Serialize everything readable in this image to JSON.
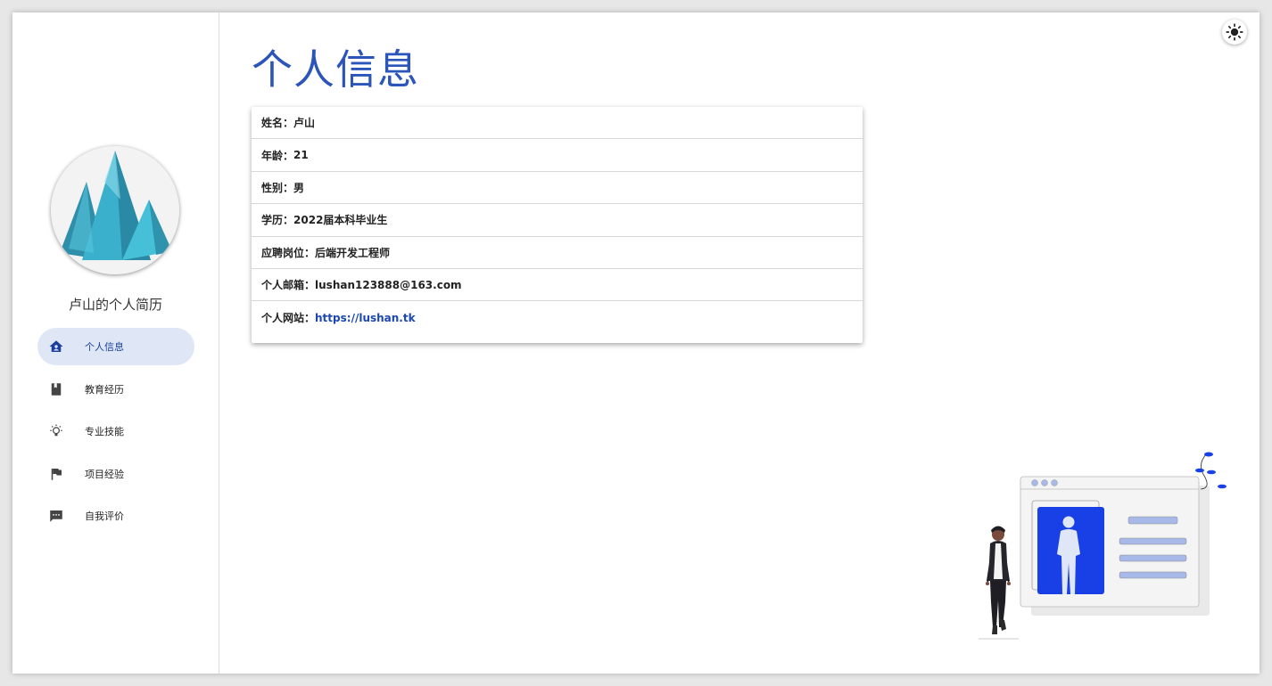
{
  "sidebar": {
    "title": "卢山的个人简历",
    "nav": [
      {
        "label": "个人信息",
        "icon": "home-icon",
        "active": true
      },
      {
        "label": "教育经历",
        "icon": "book-icon",
        "active": false
      },
      {
        "label": "专业技能",
        "icon": "lightbulb-icon",
        "active": false
      },
      {
        "label": "项目经验",
        "icon": "flag-icon",
        "active": false
      },
      {
        "label": "自我评价",
        "icon": "comment-icon",
        "active": false
      }
    ]
  },
  "main": {
    "title": "个人信息",
    "info": [
      {
        "key": "姓名：",
        "value": "卢山"
      },
      {
        "key": "年龄：",
        "value": "21"
      },
      {
        "key": "性别：",
        "value": "男"
      },
      {
        "key": "学历：",
        "value": "2022届本科毕业生"
      },
      {
        "key": "应聘岗位：",
        "value": "后端开发工程师"
      },
      {
        "key": "个人邮箱：",
        "value": "lushan123888@163.com"
      },
      {
        "key": "个人网站：",
        "value": "https://lushan.tk",
        "link": true
      }
    ]
  },
  "theme_toggle": {
    "icon": "sun-icon"
  },
  "colors": {
    "accent": "#2b55b8",
    "link": "#1a47b0",
    "active_nav_bg": "#dfe7f7",
    "illustration_blue": "#1940e6"
  }
}
